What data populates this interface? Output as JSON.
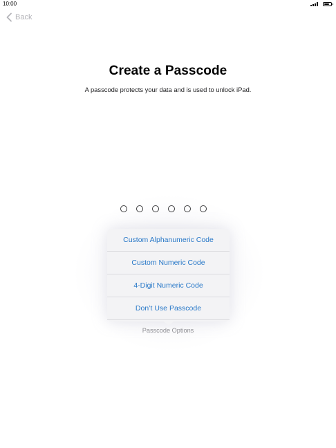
{
  "status_bar": {
    "time": "10:00",
    "signal_bars": 4,
    "battery_level": 0.8,
    "signal_icon": "signal-icon",
    "battery_icon": "battery-icon"
  },
  "nav": {
    "back_label": "Back",
    "back_icon": "chevron-left-icon"
  },
  "header": {
    "title": "Create a Passcode",
    "subtitle": "A passcode protects your data and is used to unlock iPad."
  },
  "passcode": {
    "digits": 6,
    "entered": 0
  },
  "options_menu": {
    "items": [
      {
        "label": "Custom Alphanumeric Code"
      },
      {
        "label": "Custom Numeric Code"
      },
      {
        "label": "4-Digit Numeric Code"
      },
      {
        "label": "Don’t Use Passcode"
      }
    ],
    "caption": "Passcode Options"
  },
  "colors": {
    "accent": "#2878c8",
    "back_label": "#b4b4b9",
    "caption": "#8e8e93",
    "popover_bg": "#f3f3f5"
  }
}
